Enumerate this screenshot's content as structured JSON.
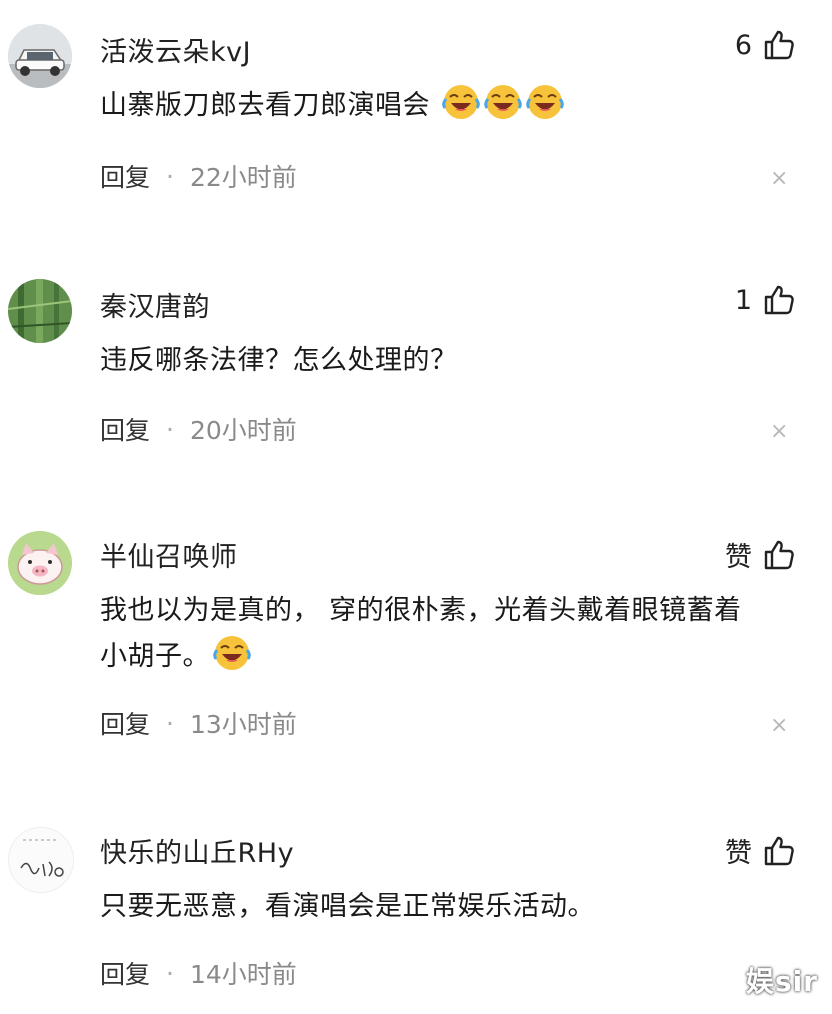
{
  "comments": [
    {
      "username": "活泼云朵kvJ",
      "likes": "6",
      "text": "山寨版刀郎去看刀郎演唱会",
      "emoji_count": 3,
      "reply_label": "回复",
      "separator": "·",
      "time": "22小时前",
      "avatar": "car-avatar"
    },
    {
      "username": "秦汉唐韵",
      "likes": "1",
      "text": "违反哪条法律？怎么处理的？",
      "reply_label": "回复",
      "separator": "·",
      "time": "20小时前",
      "avatar": "bamboo-avatar"
    },
    {
      "username": "半仙召唤师",
      "likes": "赞",
      "text_line1": "我也以为是真的， 穿的很朴素，光着头戴着眼镜蓄着",
      "text_line2": "小胡子。",
      "reply_label": "回复",
      "separator": "·",
      "time": "13小时前",
      "avatar": "pig-avatar"
    },
    {
      "username": "快乐的山丘RHy",
      "likes": "赞",
      "text": "只要无恶意，看演唱会是正常娱乐活动。",
      "reply_label": "回复",
      "separator": "·",
      "time": "14小时前",
      "avatar": "sketch-avatar"
    }
  ],
  "close_glyph": "×",
  "watermark": "娱sir",
  "colors": {
    "text": "#1a1a1a",
    "meta": "#8a8a8a",
    "emoji": "#f7c33b"
  }
}
